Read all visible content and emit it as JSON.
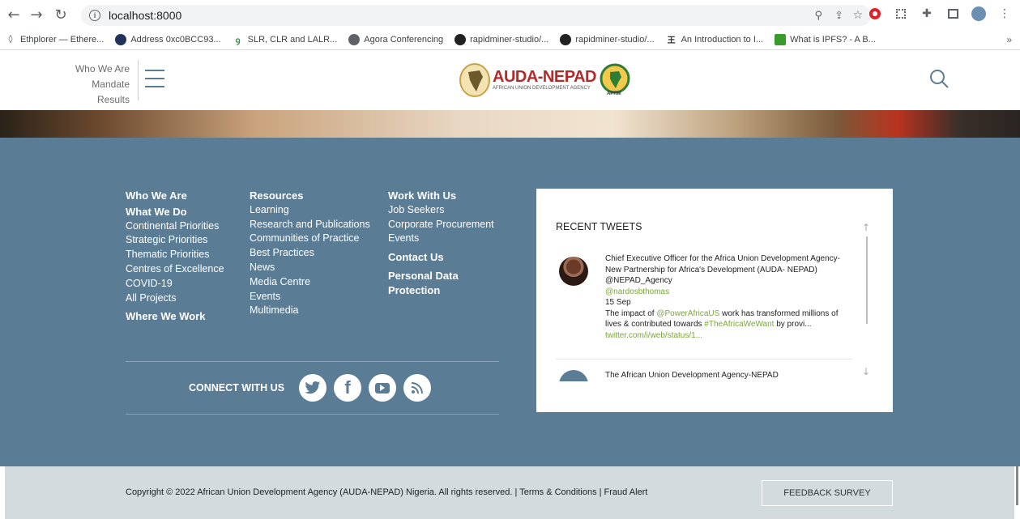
{
  "browser": {
    "url": "localhost:8000",
    "bookmarks": [
      "Ethplorer — Ethere...",
      "Address 0xc0BCC93...",
      "SLR, CLR and LALR...",
      "Agora Conferencing",
      "rapidminer-studio/...",
      "rapidminer-studio/...",
      "An Introduction to I...",
      "What is IPFS? - A B..."
    ],
    "overflow": "»"
  },
  "header": {
    "menu_items": [
      "Who We Are",
      "Mandate",
      "Results"
    ],
    "logo_text": "AUDA-NEPAD",
    "logo_subtext": "AFRICAN UNION DEVELOPMENT AGENCY",
    "aprm_text": "APRM"
  },
  "footer": {
    "col1": {
      "head1": "Who We Are",
      "head2": "What We Do",
      "links": [
        "Continental Priorities",
        "Strategic Priorities",
        "Thematic Priorities",
        "Centres of Excellence",
        "COVID-19",
        "All Projects"
      ],
      "head3": "Where We Work"
    },
    "col2": {
      "head": "Resources",
      "links": [
        "Learning",
        "Research and Publications",
        "Communities of Practice",
        "Best Practices",
        "News",
        "Media Centre",
        "Events",
        "Multimedia"
      ]
    },
    "col3": {
      "head": "Work With Us",
      "links": [
        "Job Seekers",
        "Corporate Procurement",
        "Events"
      ],
      "contact": "Contact Us",
      "personal1": "Personal Data",
      "personal2": "Protection"
    },
    "connect_label": "CONNECT WITH US",
    "tweets": {
      "title": "RECENT TWEETS",
      "tweet1": {
        "author": "Chief Executive Officer for the Africa Union Development Agency- New Partnership for Africa's Development (AUDA- NEPAD) @NEPAD_Agency",
        "handle": "@nardosbthomas",
        "date": "15 Sep",
        "text_pre": "The impact of ",
        "mention": "@PowerAfricaUS",
        "text_mid": " work has transformed millions of lives & contributed towards ",
        "hashtag": "#TheAfricaWeWant",
        "text_post": " by provi...",
        "link": "twitter.com/i/web/status/1..."
      },
      "tweet2_author": "The African Union Development Agency-NEPAD"
    }
  },
  "bottom": {
    "copyright": "Copyright © 2022 African Union Development Agency (AUDA-NEPAD) Nigeria. All rights reserved. | Terms & Conditions | Fraud Alert",
    "feedback": "FEEDBACK SURVEY"
  }
}
